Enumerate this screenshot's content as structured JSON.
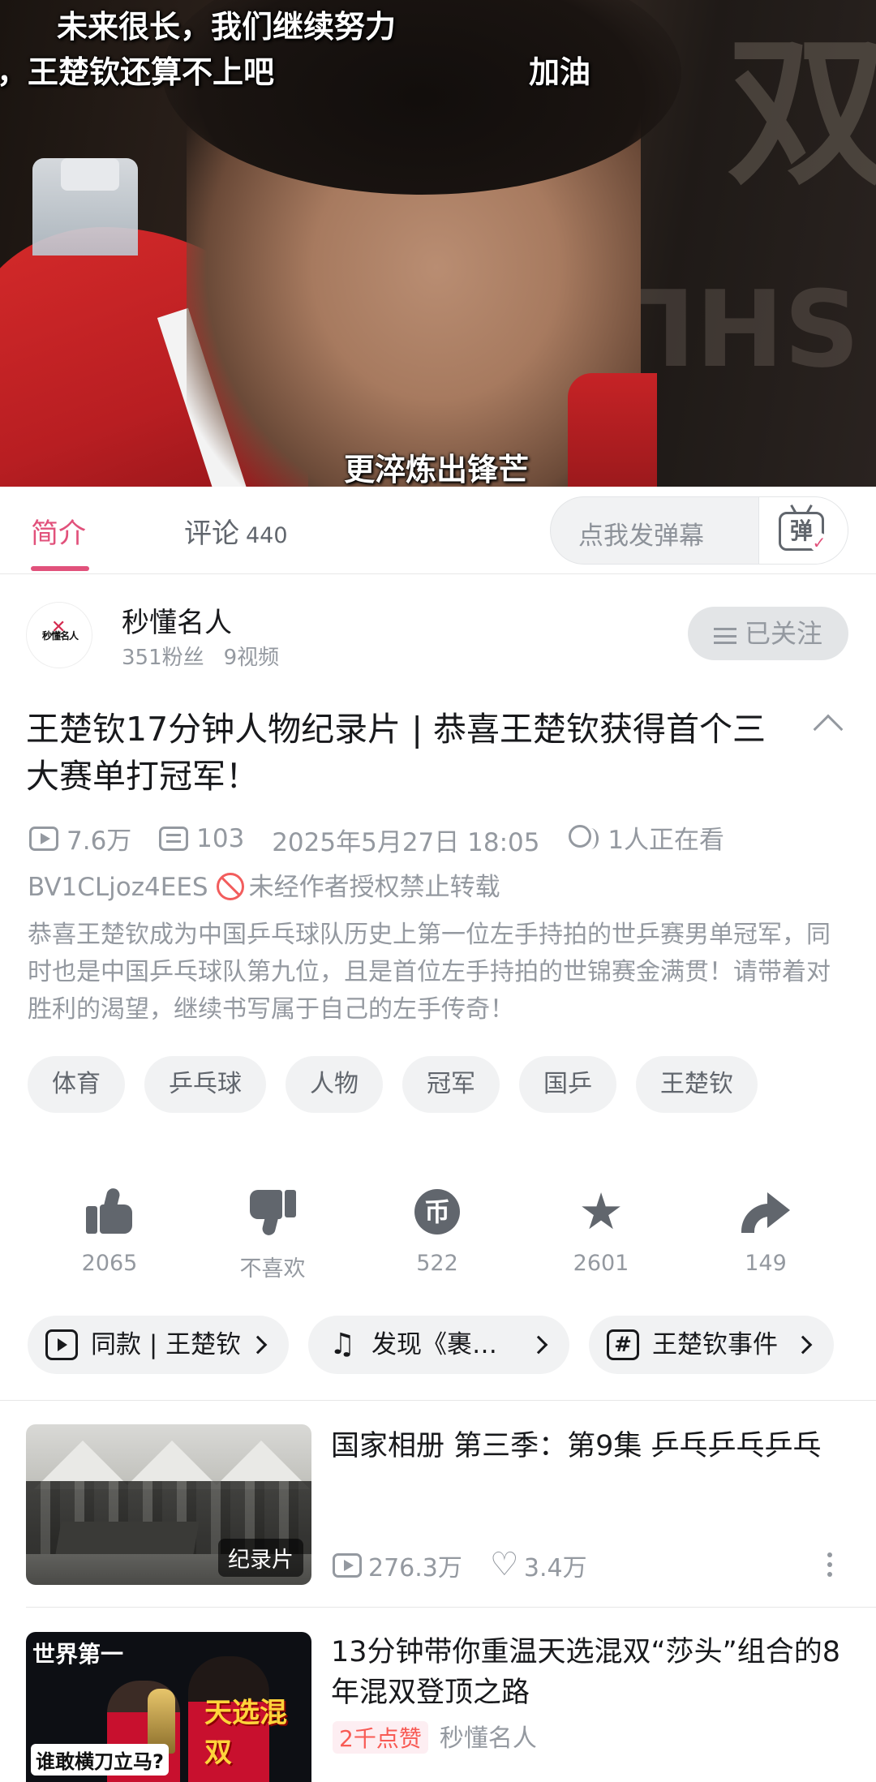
{
  "video": {
    "subtitle_top": "未来很长，我们继续努力",
    "subtitle_left": "，王楚钦还算不上吧",
    "subtitle_right": "加油",
    "subtitle_bottom": "更淬炼出锋芒"
  },
  "tabs": {
    "intro_label": "简介",
    "comments_label": "评论",
    "comments_count": "440",
    "danmaku_placeholder": "点我发弹幕",
    "danmaku_button": "弹"
  },
  "uploader": {
    "name": "秒懂名人",
    "fans": "351粉丝",
    "videos": "9视频",
    "avatar_text": "秒懂名人",
    "follow_label": "已关注"
  },
  "video_info": {
    "title": "王楚钦17分钟人物纪录片 | 恭喜王楚钦获得首个三大赛单打冠军！",
    "views": "7.6万",
    "danmaku_count": "103",
    "publish_time": "2025年5月27日 18:05",
    "watching": "1人正在看",
    "bvid": "BV1CLjoz4EES",
    "copyright": "未经作者授权禁止转载",
    "description": "恭喜王楚钦成为中国乒乓球队历史上第一位左手持拍的世乒赛男单冠军，同时也是中国乒乓球队第九位，且是首位左手持拍的世锦赛金满贯！请带着对胜利的渴望，继续书写属于自己的左手传奇！"
  },
  "tags": [
    "体育",
    "乒乓球",
    "人物",
    "冠军",
    "国乒",
    "王楚钦"
  ],
  "actions": {
    "like": "2065",
    "dislike": "不喜欢",
    "coin": "522",
    "favorite": "2601",
    "share": "149"
  },
  "chips": {
    "same_style": "同款 | 王楚钦",
    "music": "发现《裹…",
    "topic": "王楚钦事件"
  },
  "recommended": [
    {
      "title": "国家相册 第三季：第9集 乒乓乒乓乒乓",
      "badge": "纪录片",
      "views": "276.3万",
      "likes": "3.4万"
    },
    {
      "title": "13分钟带你重温天选混双“莎头”组合的8年混双登顶之路",
      "thumb_text1": "世界第一",
      "thumb_text2": "天选混双",
      "thumb_text3": "谁敢横刀立马?",
      "likes_tag": "2千点赞",
      "author": "秒懂名人"
    }
  ],
  "colors": {
    "accent": "#e1517b",
    "muted": "#9499a0",
    "text": "#18191c"
  }
}
